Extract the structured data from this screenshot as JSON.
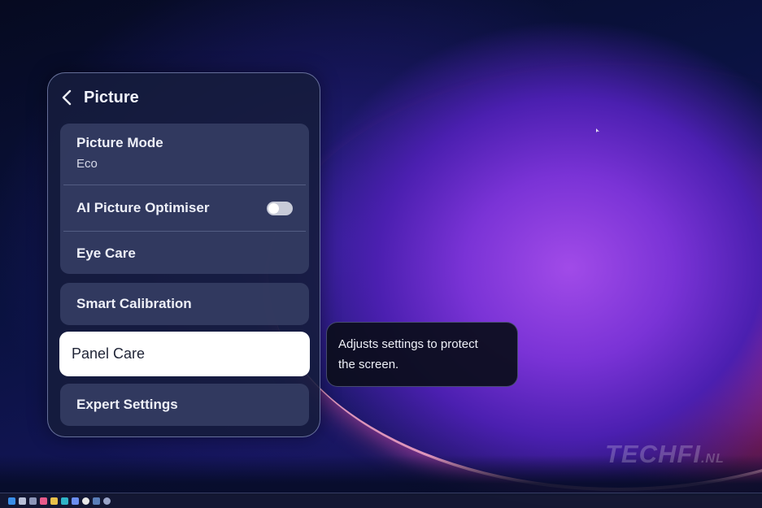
{
  "menu": {
    "title": "Picture",
    "items": {
      "picture_mode": {
        "label": "Picture Mode",
        "value": "Eco"
      },
      "ai_optimiser": {
        "label": "AI Picture Optimiser",
        "enabled": false
      },
      "eye_care": {
        "label": "Eye Care"
      },
      "smart_calibration": {
        "label": "Smart Calibration"
      },
      "panel_care": {
        "label": "Panel Care",
        "selected": true
      },
      "expert_settings": {
        "label": "Expert Settings"
      }
    }
  },
  "tooltip": {
    "text_line1": "Adjusts settings to protect",
    "text_line2": "the screen."
  },
  "watermark": {
    "brand": "TECHFI",
    "tld": ".NL"
  },
  "taskbar": {
    "icons": [
      "windows-start-icon",
      "search-icon",
      "task-view-icon",
      "widgets-icon",
      "file-explorer-icon",
      "edge-browser-icon",
      "store-icon",
      "chrome-icon",
      "steam-icon",
      "settings-icon"
    ]
  },
  "colors": {
    "panel_bg": "#161c3c",
    "row_bg": "#343c62",
    "selected_bg": "#ffffff",
    "accent_purple": "#a14be8",
    "accent_pink": "#c0306e"
  }
}
